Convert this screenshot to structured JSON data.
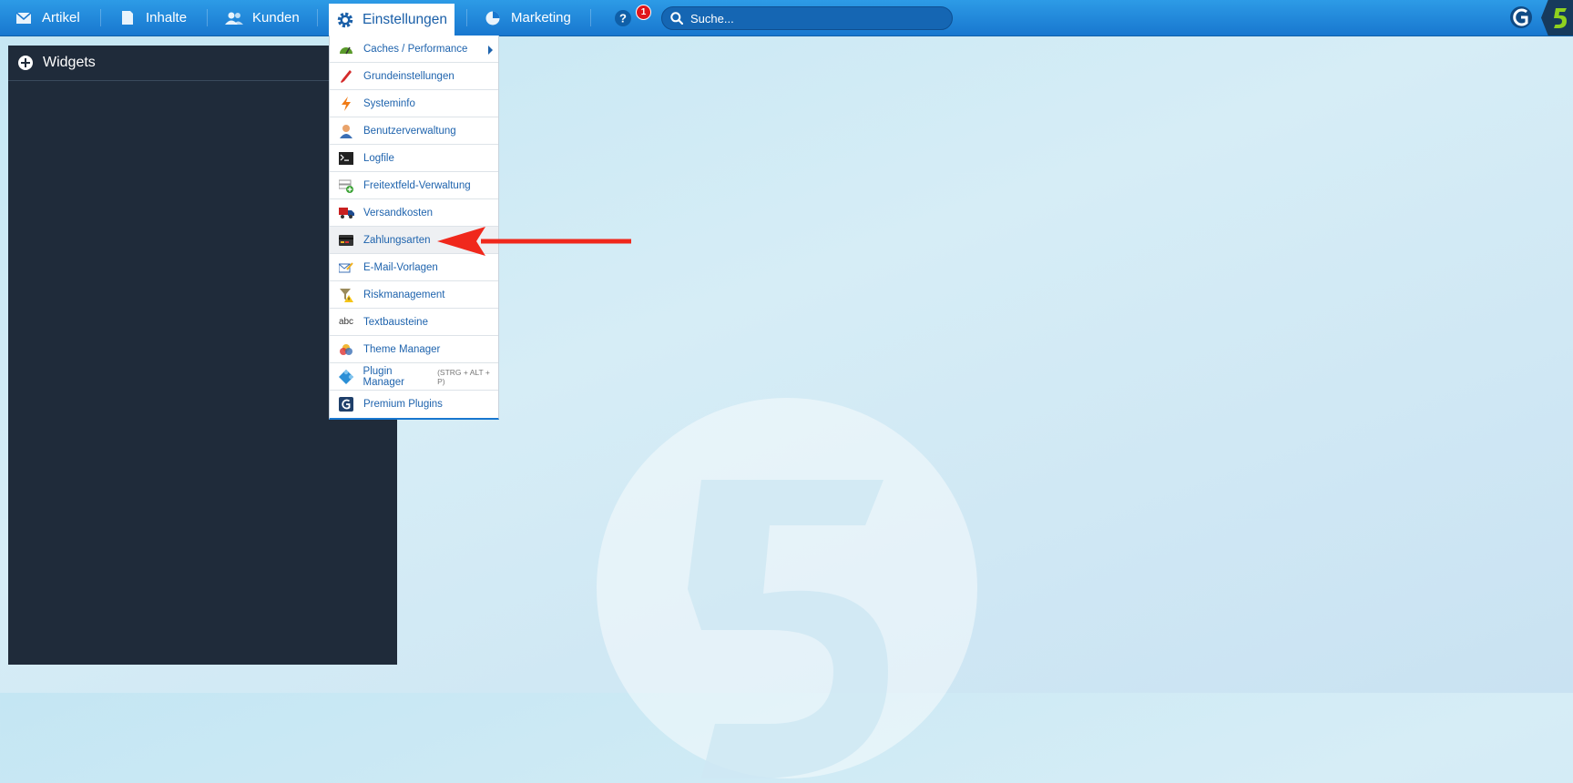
{
  "topbar": {
    "nav": [
      {
        "label": "Artikel",
        "icon": "mail-icon"
      },
      {
        "label": "Inhalte",
        "icon": "document-icon"
      },
      {
        "label": "Kunden",
        "icon": "users-icon"
      },
      {
        "label": "Einstellungen",
        "icon": "gear-icon"
      },
      {
        "label": "Marketing",
        "icon": "pie-chart-icon"
      }
    ],
    "notification_count": "1",
    "search_placeholder": "Suche..."
  },
  "widgets": {
    "title": "Widgets"
  },
  "dropdown": {
    "items": [
      {
        "label": "Caches / Performance",
        "icon": "speedometer-icon",
        "has_submenu": true
      },
      {
        "label": "Grundeinstellungen",
        "icon": "wrench-icon"
      },
      {
        "label": "Systeminfo",
        "icon": "lightning-icon"
      },
      {
        "label": "Benutzerverwaltung",
        "icon": "user-icon"
      },
      {
        "label": "Logfile",
        "icon": "terminal-icon"
      },
      {
        "label": "Freitextfeld-Verwaltung",
        "icon": "form-add-icon"
      },
      {
        "label": "Versandkosten",
        "icon": "truck-icon"
      },
      {
        "label": "Zahlungsarten",
        "icon": "credit-card-icon",
        "active": true
      },
      {
        "label": "E-Mail-Vorlagen",
        "icon": "mail-edit-icon"
      },
      {
        "label": "Riskmanagement",
        "icon": "risk-filter-icon"
      },
      {
        "label": "Textbausteine",
        "icon": "abc-icon"
      },
      {
        "label": "Theme Manager",
        "icon": "color-circles-icon"
      },
      {
        "label": "Plugin Manager",
        "hint": "(STRG + ALT + P)",
        "icon": "puzzle-icon"
      },
      {
        "label": "Premium Plugins",
        "icon": "shopware-icon"
      }
    ]
  },
  "colors": {
    "topbar": "#1c84d8",
    "panel": "#1f2b3a",
    "link": "#1e63ad",
    "arrow": "#f0281c",
    "badge": "#e0161b"
  }
}
